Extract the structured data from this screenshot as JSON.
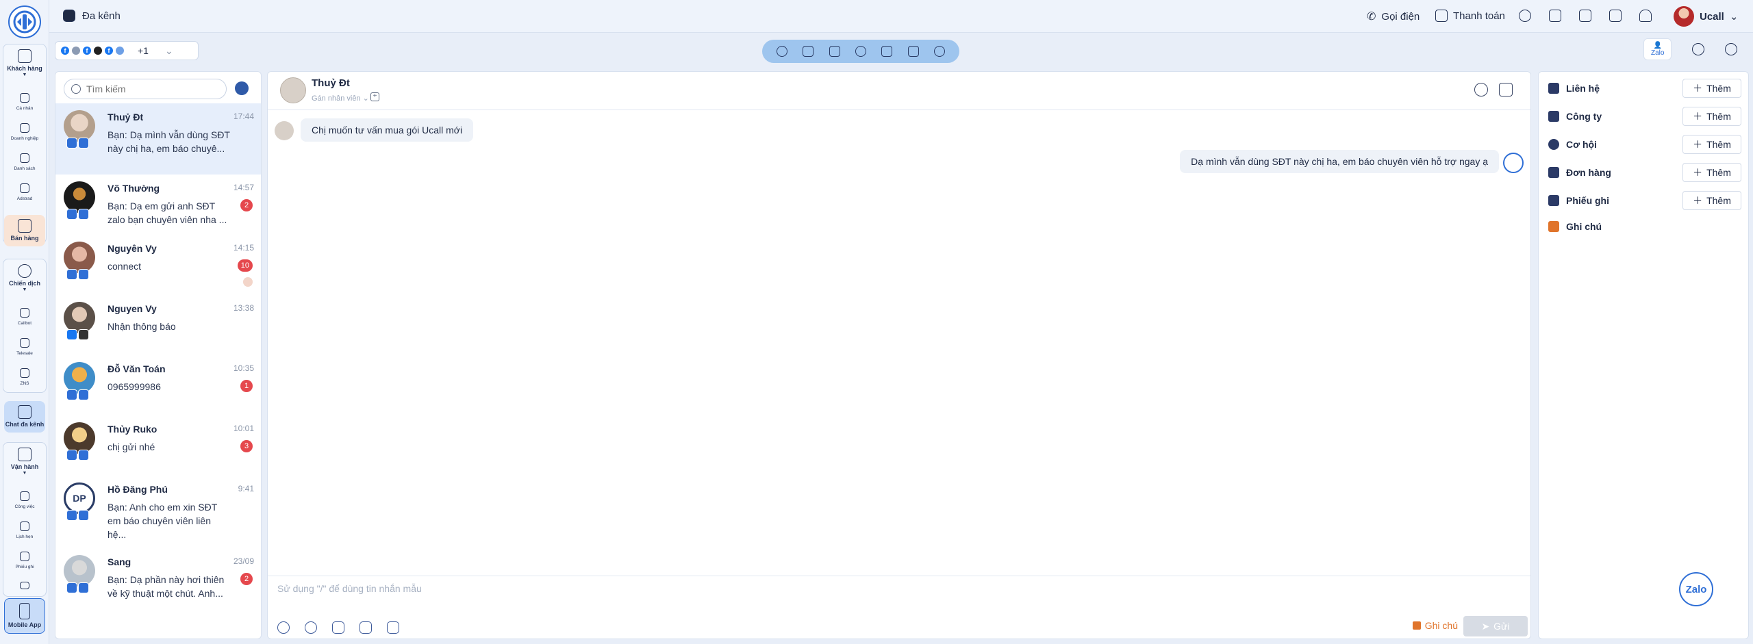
{
  "rail": {
    "items": [
      {
        "label": "Khách hàng"
      },
      {
        "label": "Cá nhân"
      },
      {
        "label": "Doanh nghiệp"
      },
      {
        "label": "Danh sách"
      },
      {
        "label": "Adstrad"
      },
      {
        "label": "Bán hàng"
      },
      {
        "label": "Chiến dịch"
      },
      {
        "label": "Callbot"
      },
      {
        "label": "Telesale"
      },
      {
        "label": "ZNS"
      },
      {
        "label": "Chat đa kênh"
      },
      {
        "label": "Vận hành"
      },
      {
        "label": "Công việc"
      },
      {
        "label": "Lịch hẹn"
      },
      {
        "label": "Phiếu ghi"
      },
      {
        "label": "Mobile App"
      }
    ]
  },
  "topbar": {
    "title": "Đa kênh",
    "call": "Gọi điện",
    "payment": "Thanh toán",
    "user": "Ucall"
  },
  "channels": {
    "more": "+1"
  },
  "search": {
    "placeholder": "Tìm kiếm"
  },
  "conversations": [
    {
      "name": "Thuỷ Đt",
      "time": "17:44",
      "preview": "Bạn: Dạ mình vẫn dùng SĐT này chị ha, em báo chuyê...",
      "unread": ""
    },
    {
      "name": "Võ Thường",
      "time": "14:57",
      "preview": "Bạn: Dạ em gửi anh SĐT zalo bạn chuyên viên nha ...",
      "unread": "2"
    },
    {
      "name": "Nguyên Vy",
      "time": "14:15",
      "preview": "connect",
      "unread": "10"
    },
    {
      "name": "Nguyen Vy",
      "time": "13:38",
      "preview": "Nhận thông báo",
      "unread": ""
    },
    {
      "name": "Đỗ Văn Toán",
      "time": "10:35",
      "preview": "0965999986",
      "unread": "1"
    },
    {
      "name": "Thủy Ruko",
      "time": "10:01",
      "preview": "chị gửi nhé",
      "unread": "3"
    },
    {
      "name": "Hồ Đăng Phú",
      "time": "9:41",
      "preview": "Bạn: Anh cho em xin SĐT em báo chuyên viên liên hệ...",
      "unread": ""
    },
    {
      "name": "Sang",
      "time": "23/09",
      "preview": "Bạn: Dạ phần này hơi thiên về kỹ thuật một chút. Anh...",
      "unread": "2"
    }
  ],
  "chat": {
    "name": "Thuỷ Đt",
    "assign": "Gán nhân viên",
    "msg_in": "Chị muốn tư vấn mua gói Ucall mới",
    "msg_out": "Dạ mình vẫn dùng SĐT này chị ha, em báo chuyên viên hỗ trợ ngay ạ",
    "composer_placeholder": "Sử dụng \"/\" để dùng tin nhắn mẫu",
    "note": "Ghi chú",
    "send": "Gửi"
  },
  "side": {
    "zalo_tab": "Zalo",
    "add_label": "Thêm",
    "rows": [
      {
        "label": "Liên hệ"
      },
      {
        "label": "Công ty"
      },
      {
        "label": "Cơ hội"
      },
      {
        "label": "Đơn hàng"
      },
      {
        "label": "Phiếu ghi"
      },
      {
        "label": "Ghi chú"
      }
    ],
    "fab": "Zalo"
  },
  "colors": {
    "accent": "#2f6fd6",
    "unread": "#e5484d",
    "note": "#e0742b"
  }
}
